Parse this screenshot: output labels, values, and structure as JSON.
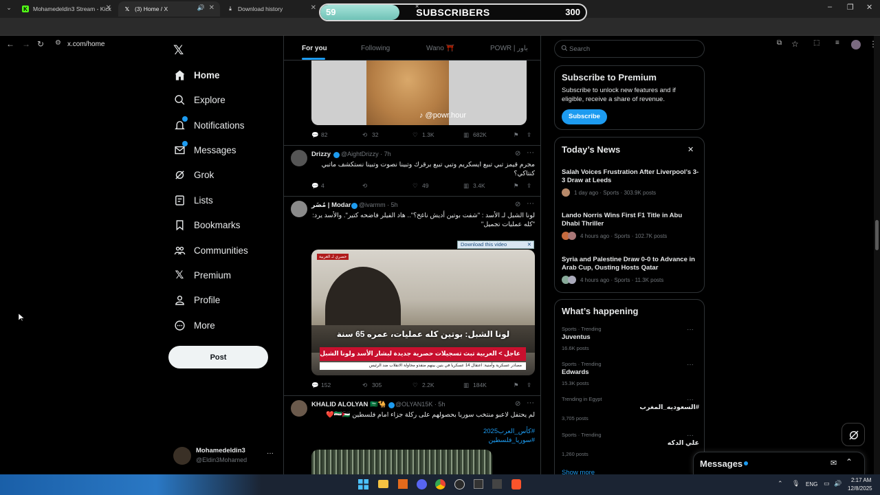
{
  "browser": {
    "tabs": [
      {
        "title": "Mohamedeldin3 Stream - Kick",
        "active": false
      },
      {
        "title": "(3) Home / X",
        "active": true
      },
      {
        "title": "Download history",
        "active": false
      }
    ],
    "url": "x.com/home"
  },
  "overlay": {
    "current": "59",
    "label": "SUBSCRIBERS",
    "goal": "300",
    "close": "×",
    "progress": 0.197
  },
  "sidebar": {
    "items": [
      {
        "label": "Home",
        "icon": "home-icon"
      },
      {
        "label": "Explore",
        "icon": "search-icon"
      },
      {
        "label": "Notifications",
        "icon": "bell-icon"
      },
      {
        "label": "Messages",
        "icon": "envelope-icon"
      },
      {
        "label": "Grok",
        "icon": "grok-icon"
      },
      {
        "label": "Lists",
        "icon": "list-icon"
      },
      {
        "label": "Bookmarks",
        "icon": "bookmark-icon"
      },
      {
        "label": "Communities",
        "icon": "people-icon"
      },
      {
        "label": "Premium",
        "icon": "x-logo-icon"
      },
      {
        "label": "Profile",
        "icon": "person-icon"
      },
      {
        "label": "More",
        "icon": "more-circle-icon"
      }
    ],
    "post_label": "Post",
    "account": {
      "name": "Mohamedeldin3",
      "handle": "@Eldin3Mohamed",
      "more": "···"
    }
  },
  "feed": {
    "tabs": [
      "For you",
      "Following",
      "Wano ⛩️",
      "POWR | باور"
    ],
    "tweets": [
      {
        "watermark": "♪ @powr.hour",
        "stats": {
          "replies": "82",
          "reposts": "32",
          "likes": "1.3K",
          "views": "682K"
        }
      },
      {
        "name": "Drizzy",
        "handle": "@AightDrizzy · 7h",
        "text": "مجرم قيمز تبي تبيع ايسكريم وتبي تبيع برقرك وتبينا نصوت وتبينا نستكشف ماتبي كنتاكي؟",
        "stats": {
          "replies": "4",
          "reposts": "",
          "likes": "49",
          "views": "3.4K"
        }
      },
      {
        "name": "مُضَر | Modar",
        "handle": "@ivarmm · 5h",
        "text": "لونا الشبل لـ الأسد : \"شفت بوتين أديش ناغخ؟\".. هاد الفيلر فاضحه كتير\". والأسد يرد: \"كله عمليات تجميل\"",
        "download_label": "Download this video",
        "video_caption_1": "لونا الشبل: بوتين كله عمليات، عمره 65 سنة",
        "video_caption_2": "عاجل > العربية تبث تسجيلات حصرية جديدة لبشار الأسد ولونا الشبل",
        "video_caption_3": "مصادر عسكرية وأمنية: اعتقال 14 عسكريا في بنين بينهم منفذو محاولة الانقلاب ضد الرئيس",
        "video_tag": "حصري لـ العربية",
        "stats": {
          "replies": "152",
          "reposts": "305",
          "likes": "2.2K",
          "views": "184K"
        }
      },
      {
        "name": "KHALID ALOLYAN 🇸🇦🐪",
        "handle": "@OLYAN15K · 5h",
        "text": "لم يحتفل لاعبو منتخب سوريا بحصولهم على ركلة جزاء امام فلسطين 🇸🇾🇵🇸❤️",
        "hashtag1": "#كأس_العرب2025",
        "hashtag2": "#سوريا_فلسطين"
      }
    ]
  },
  "right": {
    "search_placeholder": "Search",
    "premium": {
      "title": "Subscribe to Premium",
      "text": "Subscribe to unlock new features and if eligible, receive a share of revenue.",
      "button": "Subscribe"
    },
    "news": {
      "title": "Today’s News",
      "items": [
        {
          "headline": "Salah Voices Frustration After Liverpool’s 3-3 Draw at Leeds",
          "meta": "1 day ago · Sports · 303.9K posts"
        },
        {
          "headline": "Lando Norris Wins First F1 Title in Abu Dhabi Thriller",
          "meta": "4 hours ago · Sports · 102.7K posts"
        },
        {
          "headline": "Syria and Palestine Draw 0-0 to Advance in Arab Cup, Ousting Hosts Qatar",
          "meta": "4 hours ago · Sports · 11.3K posts"
        }
      ]
    },
    "happening": {
      "title": "What’s happening",
      "trends": [
        {
          "category": "Sports · Trending",
          "name": "Juventus",
          "count": "16.6K posts"
        },
        {
          "category": "Sports · Trending",
          "name": "Edwards",
          "count": "15.3K posts"
        },
        {
          "category": "Trending in Egypt",
          "name": "#السعوديه_المغرب",
          "count": "3,705 posts"
        },
        {
          "category": "Sports · Trending",
          "name": "علي الدكه",
          "count": "1,260 posts"
        }
      ],
      "show_more": "Show more"
    },
    "messages_label": "Messages"
  },
  "taskbar": {
    "lang": "ENG",
    "time": "2:17 AM",
    "date": "12/8/2025"
  },
  "colors": {
    "accent": "#1d9bf0",
    "background": "#000000",
    "border": "#2f3336",
    "muted": "#71767b"
  }
}
